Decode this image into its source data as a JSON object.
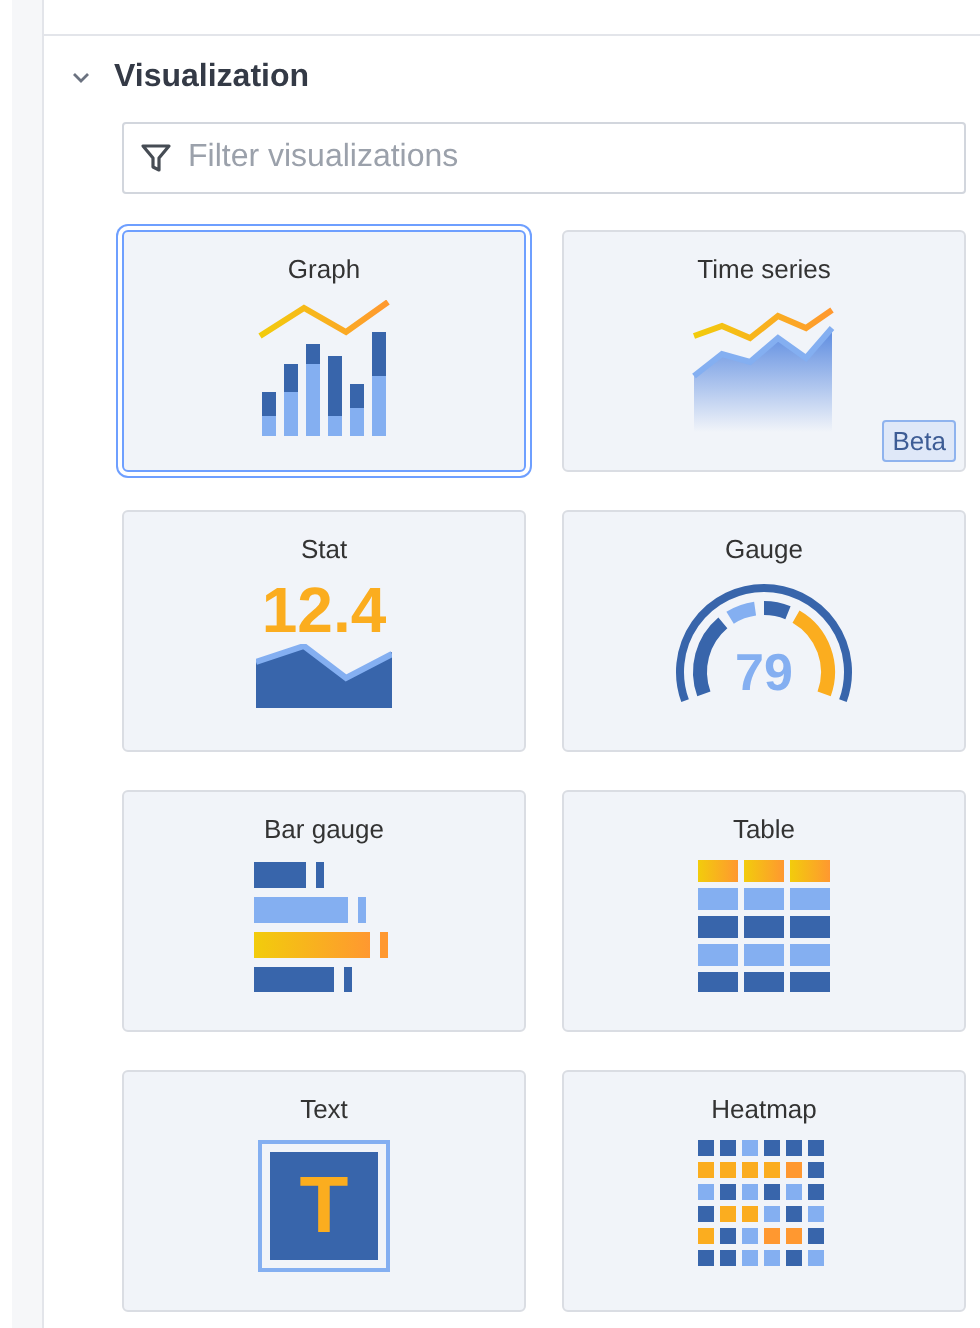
{
  "section": {
    "title": "Visualization",
    "expanded": true
  },
  "filter": {
    "placeholder": "Filter visualizations"
  },
  "cards": [
    {
      "name": "Graph",
      "kind": "graph",
      "selected": true
    },
    {
      "name": "Time series",
      "kind": "timeseries",
      "selected": false,
      "badge": "Beta"
    },
    {
      "name": "Stat",
      "kind": "stat",
      "selected": false,
      "value": "12.4"
    },
    {
      "name": "Gauge",
      "kind": "gauge",
      "selected": false,
      "value": "79"
    },
    {
      "name": "Bar gauge",
      "kind": "bargauge",
      "selected": false
    },
    {
      "name": "Table",
      "kind": "table",
      "selected": false
    },
    {
      "name": "Text",
      "kind": "text",
      "selected": false,
      "value": "T"
    },
    {
      "name": "Heatmap",
      "kind": "heatmap",
      "selected": false
    }
  ]
}
